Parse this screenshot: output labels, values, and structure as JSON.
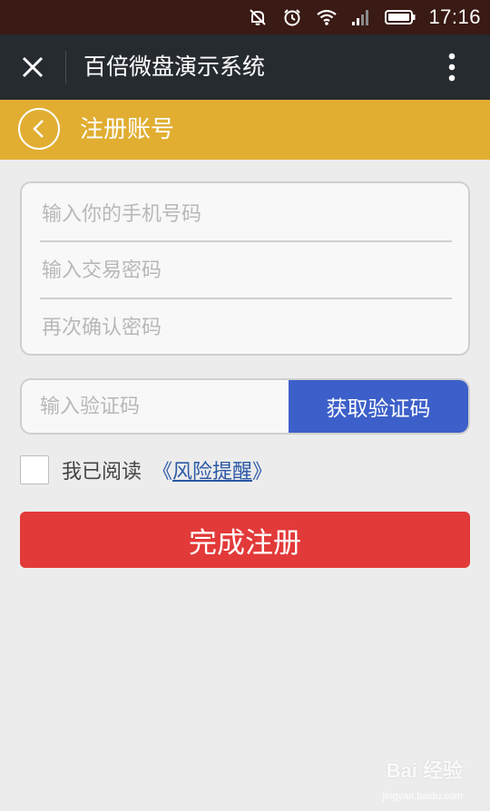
{
  "status_bar": {
    "time": "17:16"
  },
  "app_bar": {
    "title": "百倍微盘演示系统"
  },
  "page_header": {
    "title": "注册账号"
  },
  "form": {
    "phone_placeholder": "输入你的手机号码",
    "trade_password_placeholder": "输入交易密码",
    "confirm_password_placeholder": "再次确认密码"
  },
  "verification": {
    "code_placeholder": "输入验证码",
    "get_code_label": "获取验证码"
  },
  "agreement": {
    "text": "我已阅读",
    "link_open": "《",
    "link_label": "风险提醒",
    "link_close": "》",
    "checked": false
  },
  "submit": {
    "label": "完成注册"
  },
  "watermark": {
    "text": "Bai 经验",
    "url_text": "jingyan.baidu.com"
  },
  "colors": {
    "status_bar": "#3a1a14",
    "app_bar": "#262b30",
    "header": "#e1ae32",
    "get_code_button": "#3c5fc9",
    "submit_button": "#e23a39",
    "link": "#2b58a6",
    "background": "#ececec"
  },
  "icons": {
    "status": [
      "notifications-muted-icon",
      "alarm-icon",
      "wifi-icon",
      "signal-icon",
      "battery-icon"
    ],
    "close": "close-icon",
    "more": "more-vertical-icon",
    "back": "chevron-left-icon"
  }
}
